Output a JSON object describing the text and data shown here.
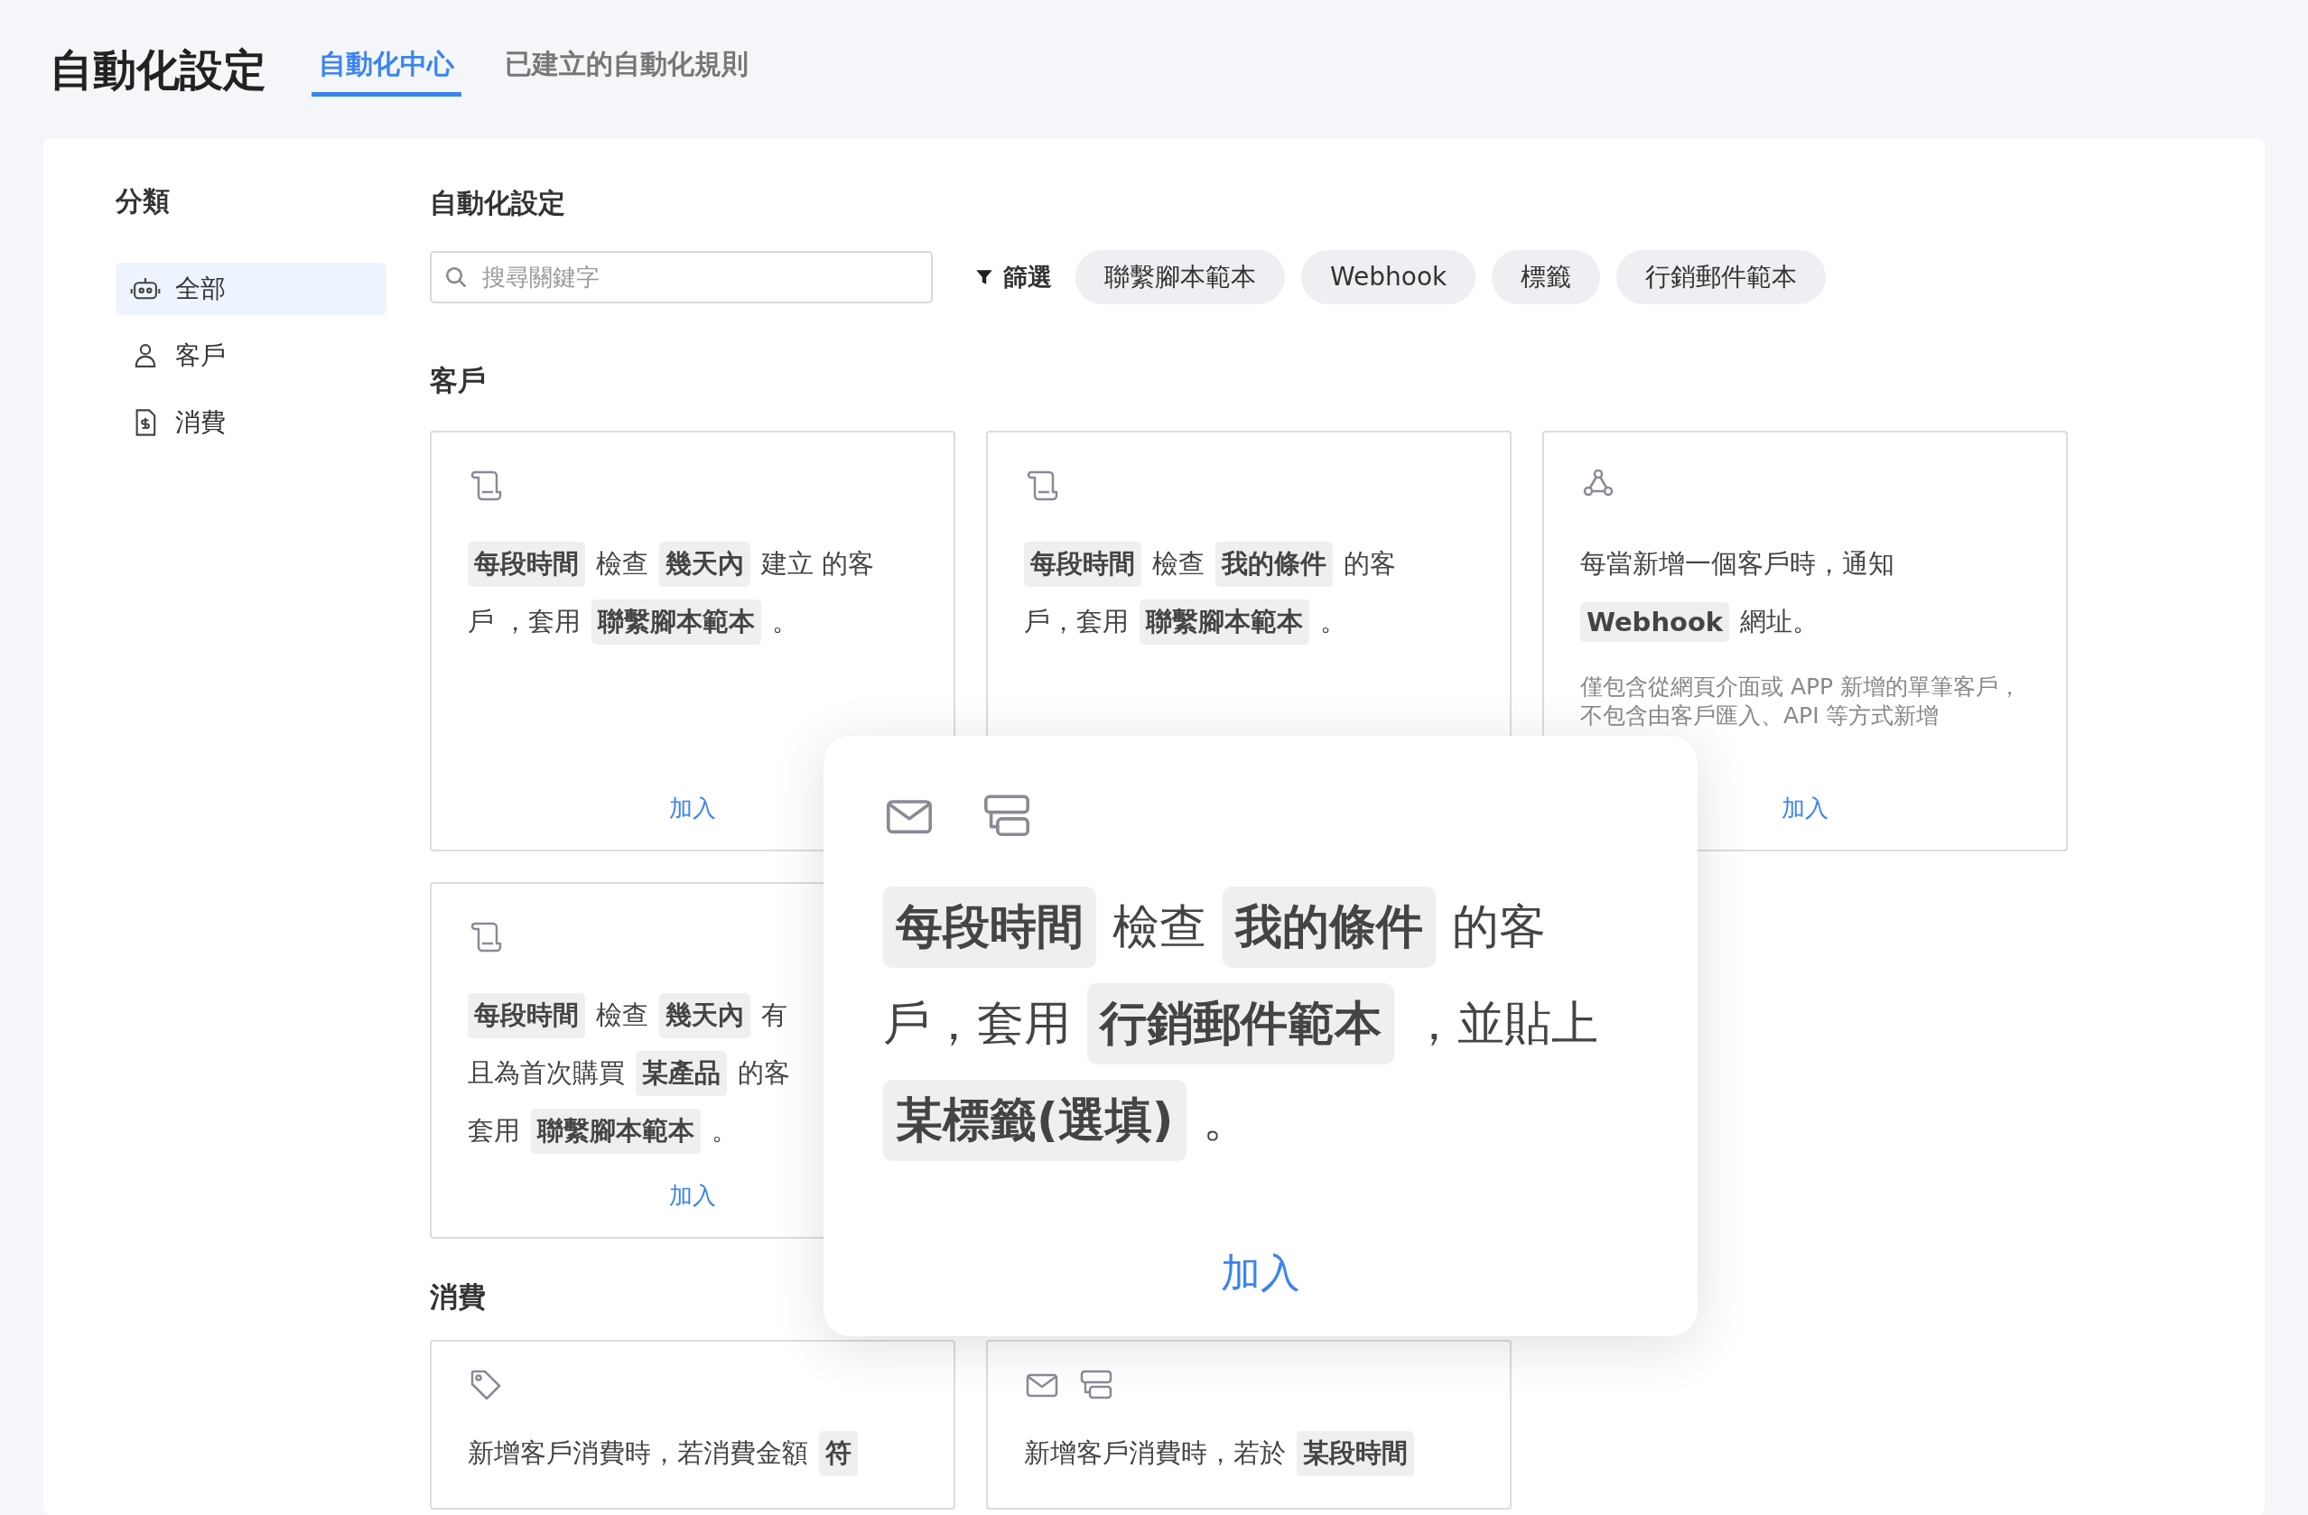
{
  "header": {
    "title": "自動化設定",
    "tabs": [
      {
        "label": "自動化中心",
        "selected": true
      },
      {
        "label": "已建立的自動化規則",
        "selected": false
      }
    ]
  },
  "sidebar": {
    "title": "分類",
    "items": [
      {
        "label": "全部",
        "selected": true
      },
      {
        "label": "客戶",
        "selected": false
      },
      {
        "label": "消費",
        "selected": false
      }
    ]
  },
  "main": {
    "title": "自動化設定",
    "search": {
      "placeholder": "搜尋關鍵字"
    },
    "filter": {
      "label": "篩選"
    },
    "chips": [
      "聯繫腳本範本",
      "Webhook",
      "標籤",
      "行銷郵件範本"
    ],
    "sections": [
      {
        "title": "客戶",
        "cards": [
          {
            "kind": "script",
            "lines": [
              [
                {
                  "text": "每段時間",
                  "chip": true
                },
                {
                  "text": "檢查",
                  "chip": false
                },
                {
                  "text": "幾天內",
                  "chip": true
                },
                {
                  "text": "建立 的客",
                  "chip": false
                }
              ],
              [
                {
                  "text": "戶 ，套用",
                  "chip": false
                },
                {
                  "text": "聯繫腳本範本",
                  "chip": true
                },
                {
                  "text": "。",
                  "chip": false
                }
              ]
            ],
            "action": "加入"
          },
          {
            "kind": "script",
            "lines": [
              [
                {
                  "text": "每段時間",
                  "chip": true
                },
                {
                  "text": "檢查",
                  "chip": false
                },
                {
                  "text": "我的條件",
                  "chip": true
                },
                {
                  "text": "的客",
                  "chip": false
                }
              ],
              [
                {
                  "text": "戶，套用",
                  "chip": false
                },
                {
                  "text": "聯繫腳本範本",
                  "chip": true
                },
                {
                  "text": "。",
                  "chip": false
                }
              ]
            ]
          },
          {
            "kind": "webhook",
            "lines": [
              [
                {
                  "text": "每當新增一個客戶時，通知",
                  "chip": false
                }
              ],
              [
                {
                  "text": "Webhook",
                  "chip": true
                },
                {
                  "text": "網址。",
                  "chip": false
                }
              ]
            ],
            "note": "僅包含從網頁介面或 APP 新增的單筆客戶，不包含由客戶匯入、API 等方式新增",
            "action": "加入"
          },
          {
            "kind": "script",
            "lines": [
              [
                {
                  "text": "每段時間",
                  "chip": true
                },
                {
                  "text": "檢查",
                  "chip": false
                },
                {
                  "text": "幾天內",
                  "chip": true
                },
                {
                  "text": "有",
                  "chip": false
                }
              ],
              [
                {
                  "text": "且為首次購買",
                  "chip": false
                },
                {
                  "text": "某產品",
                  "chip": true
                },
                {
                  "text": "的客",
                  "chip": false
                }
              ],
              [
                {
                  "text": "套用",
                  "chip": false
                },
                {
                  "text": "聯繫腳本範本",
                  "chip": true
                },
                {
                  "text": "。",
                  "chip": false
                }
              ]
            ],
            "action": "加入"
          }
        ]
      },
      {
        "title": "消費",
        "cards": [
          {
            "kind": "tag",
            "lines": [
              [
                {
                  "text": "新增客戶消費時，若消費金額",
                  "chip": false
                },
                {
                  "text": "符",
                  "chip": true
                }
              ]
            ]
          },
          {
            "kind": "campaign",
            "lines": [
              [
                {
                  "text": "新增客戶消費時，若於",
                  "chip": false
                },
                {
                  "text": "某段時間",
                  "chip": true
                }
              ]
            ]
          }
        ]
      }
    ]
  },
  "popup": {
    "kind": "campaign",
    "lines": [
      [
        {
          "text": "每段時間",
          "chip": true
        },
        {
          "text": "檢查",
          "chip": false
        },
        {
          "text": "我的條件",
          "chip": true
        },
        {
          "text": "的客",
          "chip": false
        }
      ],
      [
        {
          "text": "戶，套用",
          "chip": false
        },
        {
          "text": "行銷郵件範本",
          "chip": true
        },
        {
          "text": "，並貼上",
          "chip": false
        }
      ],
      [
        {
          "text": "某標籤(選填)",
          "chip": true
        },
        {
          "text": "。",
          "chip": false
        }
      ]
    ],
    "action": "加入"
  }
}
